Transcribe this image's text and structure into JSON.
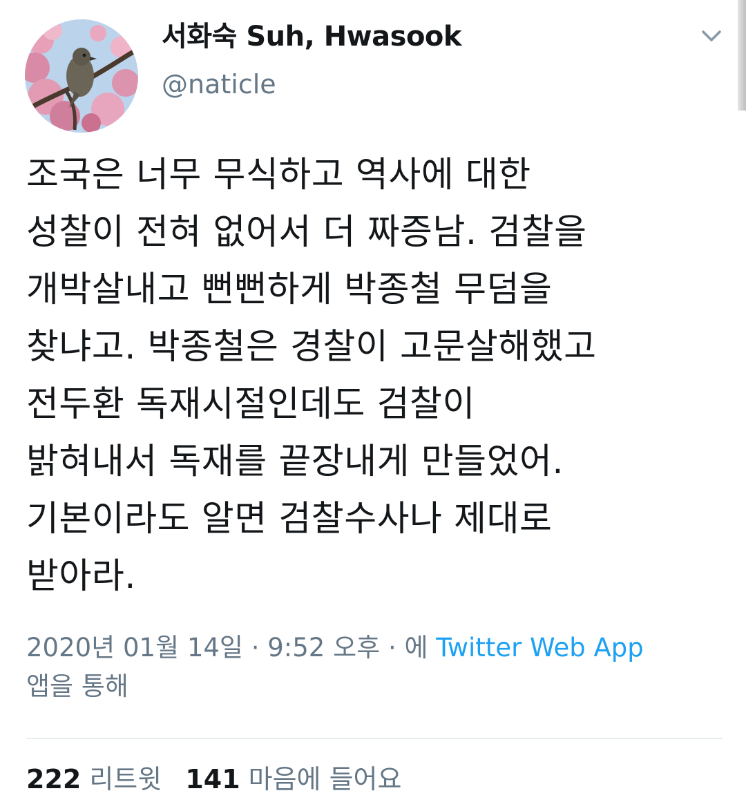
{
  "user": {
    "display_name": "서화숙 Suh, Hwasook",
    "handle": "@naticle",
    "avatar_icon": "avatar-bird-on-blossom-branch"
  },
  "tweet": {
    "lines": [
      "조국은 너무 무식하고 역사에 대한",
      "성찰이 전혀 없어서 더 짜증남. 검찰을",
      "개박살내고 뻔뻔하게 박종철 무덤을",
      "찾냐고. 박종철은 경찰이 고문살해했고",
      "전두환 독재시절인데도 검찰이",
      "밝혀내서 독재를 끝장내게 만들었어.",
      "기본이라도 알면 검찰수사나 제대로",
      "받아라."
    ]
  },
  "meta": {
    "timestamp": "2020년 01월 14일 · 9:52 오후 · 에",
    "source": "Twitter Web App",
    "source_suffix": "앱을 통해"
  },
  "stats": {
    "retweets_count": "222",
    "retweets_label": "리트윗",
    "likes_count": "141",
    "likes_label": "마음에 들어요"
  },
  "colors": {
    "text": "#14171a",
    "secondary": "#657786",
    "link": "#1da1f2",
    "divider": "#e6ecf0"
  },
  "icons": {
    "caret": "chevron-down-icon"
  }
}
